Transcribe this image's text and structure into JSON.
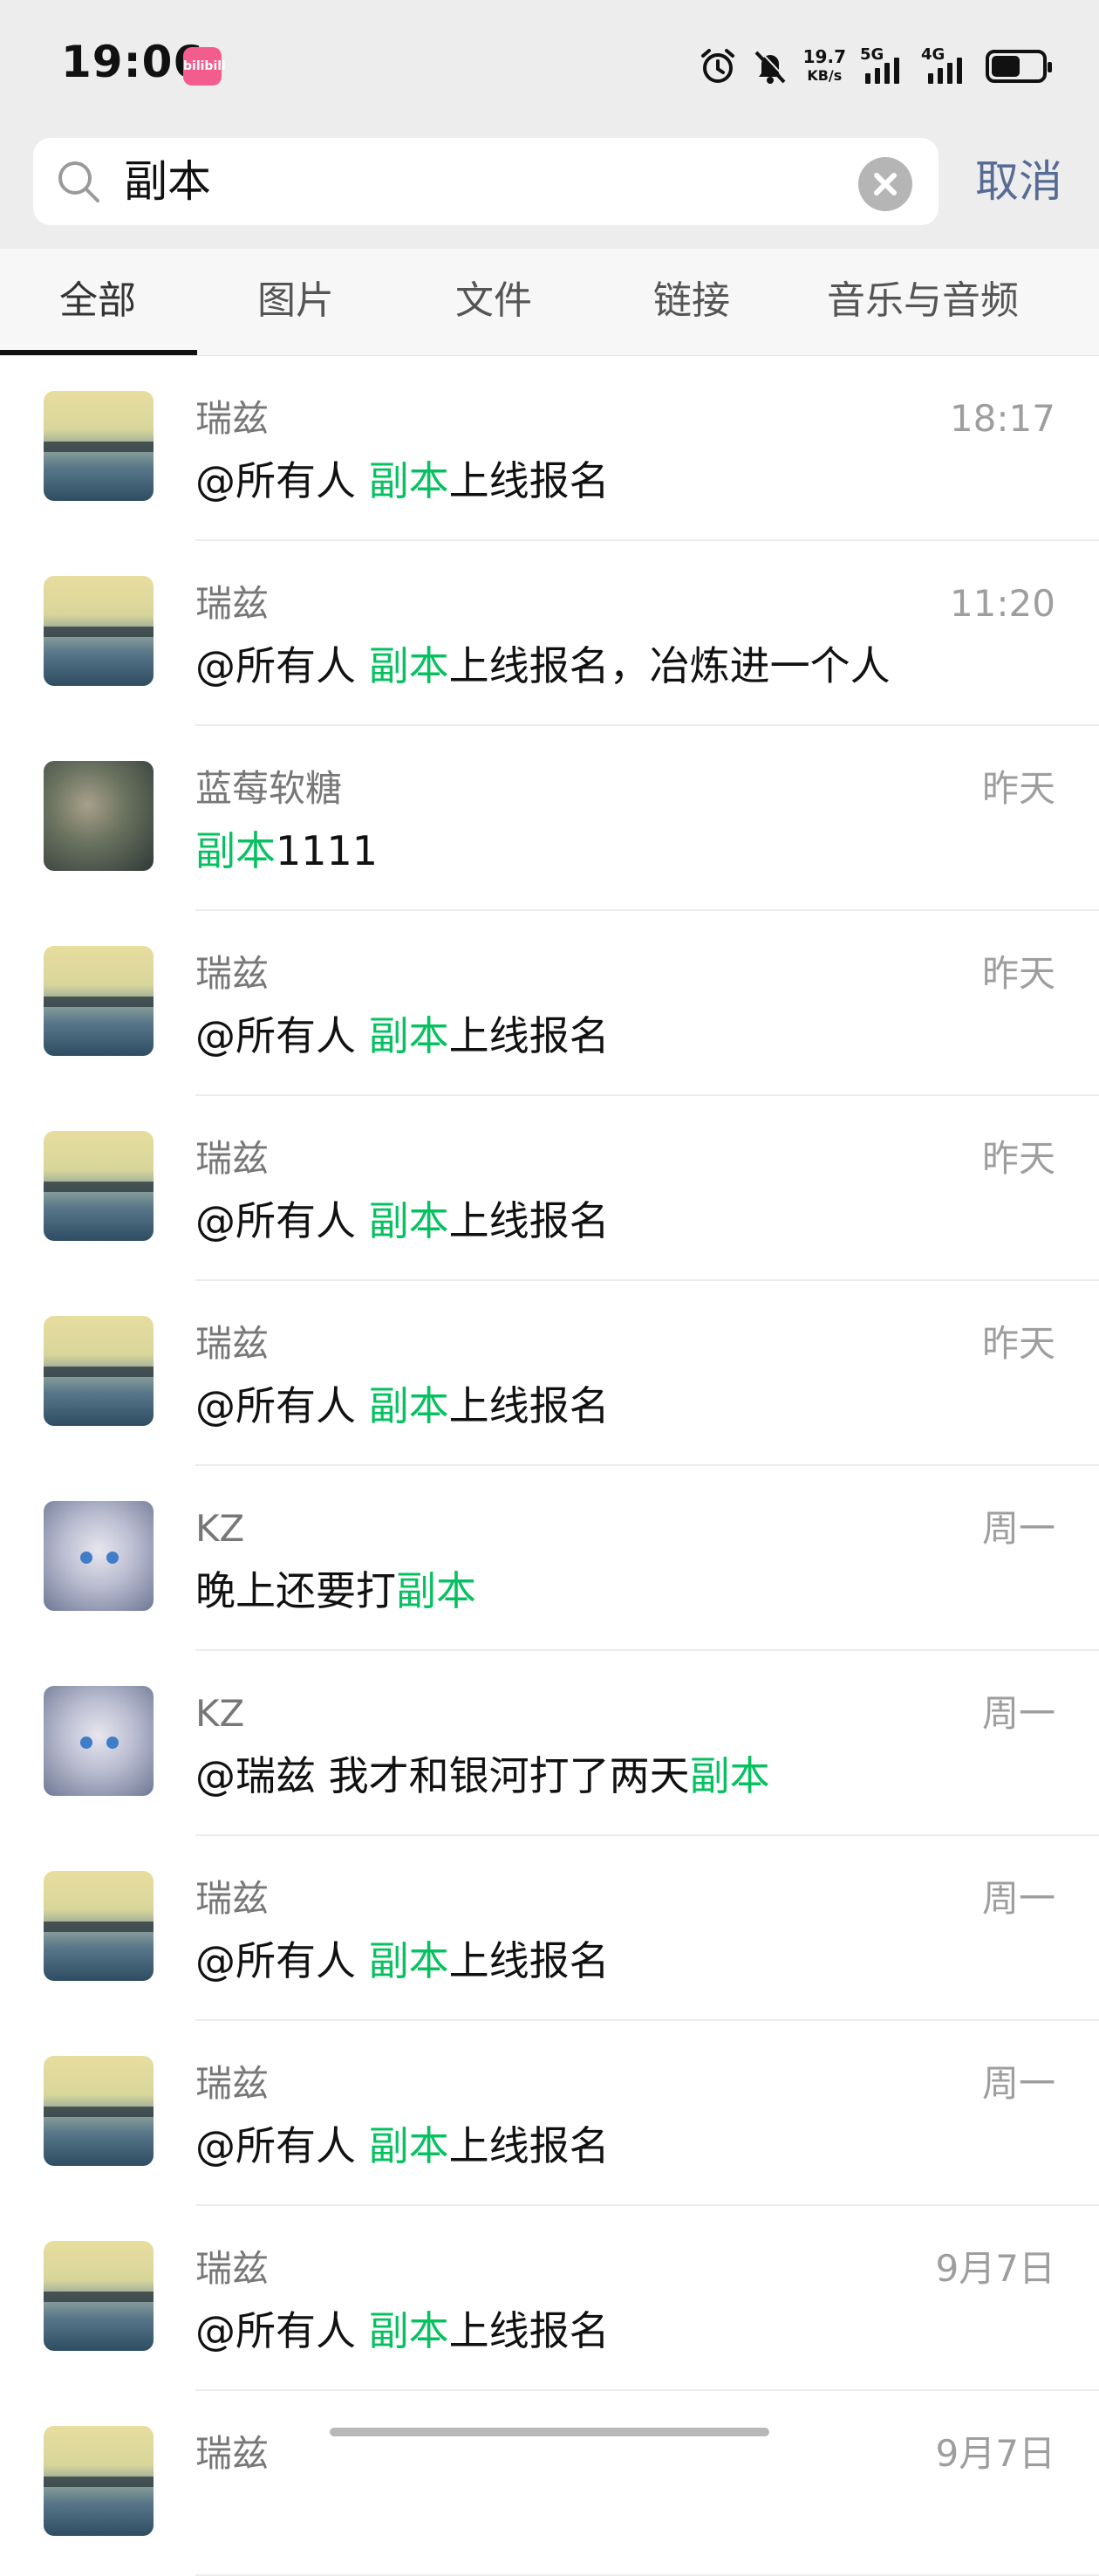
{
  "status_bar": {
    "time": "19:06",
    "app_badge": "bilibili",
    "net_speed": "19.7",
    "net_unit": "KB/s",
    "sim1": "5G",
    "sim2": "4G"
  },
  "search": {
    "query": "副本",
    "cancel_label": "取消"
  },
  "tabs": [
    "全部",
    "图片",
    "文件",
    "链接",
    "音乐与音频"
  ],
  "active_tab": "全部",
  "highlight_color": "#07c160",
  "results": [
    {
      "name": "瑞兹",
      "date": "18:17",
      "avatar": "sea-sunset",
      "prefix": "@所有人 ",
      "highlight": "副本",
      "suffix": "上线报名"
    },
    {
      "name": "瑞兹",
      "date": "11:20",
      "avatar": "sea-sunset",
      "prefix": "@所有人 ",
      "highlight": "副本",
      "suffix": "上线报名，冶炼进一个人"
    },
    {
      "name": "蓝莓软糖",
      "date": "昨天",
      "avatar": "photo",
      "prefix": "",
      "highlight": "副本",
      "suffix": "1111"
    },
    {
      "name": "瑞兹",
      "date": "昨天",
      "avatar": "sea-sunset",
      "prefix": "@所有人 ",
      "highlight": "副本",
      "suffix": "上线报名"
    },
    {
      "name": "瑞兹",
      "date": "昨天",
      "avatar": "sea-sunset",
      "prefix": "@所有人 ",
      "highlight": "副本",
      "suffix": "上线报名"
    },
    {
      "name": "瑞兹",
      "date": "昨天",
      "avatar": "sea-sunset",
      "prefix": "@所有人 ",
      "highlight": "副本",
      "suffix": "上线报名"
    },
    {
      "name": "KZ",
      "date": "周一",
      "avatar": "anime",
      "prefix": "晚上还要打",
      "highlight": "副本",
      "suffix": ""
    },
    {
      "name": "KZ",
      "date": "周一",
      "avatar": "anime",
      "prefix": "@瑞兹 我才和银河打了两天",
      "highlight": "副本",
      "suffix": ""
    },
    {
      "name": "瑞兹",
      "date": "周一",
      "avatar": "sea-sunset",
      "prefix": "@所有人 ",
      "highlight": "副本",
      "suffix": "上线报名"
    },
    {
      "name": "瑞兹",
      "date": "周一",
      "avatar": "sea-sunset",
      "prefix": "@所有人 ",
      "highlight": "副本",
      "suffix": "上线报名"
    },
    {
      "name": "瑞兹",
      "date": "9月7日",
      "avatar": "sea-sunset",
      "prefix": "@所有人 ",
      "highlight": "副本",
      "suffix": "上线报名"
    },
    {
      "name": "瑞兹",
      "date": "9月7日",
      "avatar": "sea-sunset",
      "prefix": "",
      "highlight": "",
      "suffix": ""
    }
  ]
}
